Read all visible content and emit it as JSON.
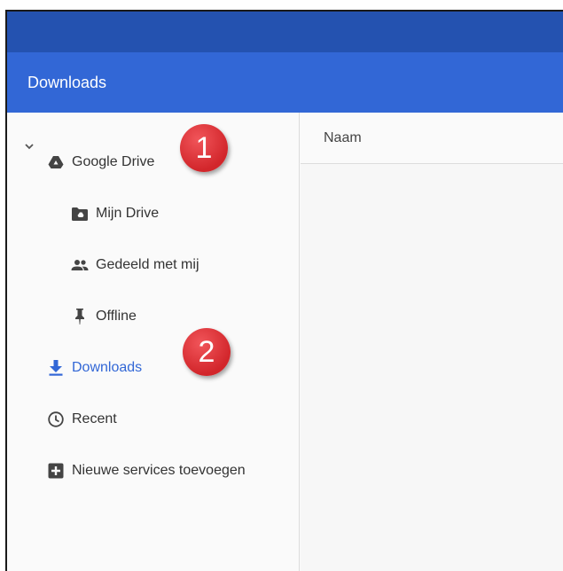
{
  "header": {
    "title": "Downloads"
  },
  "sidebar": {
    "items": [
      {
        "label": "Google Drive",
        "icon": "google-drive-icon"
      },
      {
        "label": "Mijn Drive",
        "icon": "my-drive-folder-icon"
      },
      {
        "label": "Gedeeld met mij",
        "icon": "shared-people-icon"
      },
      {
        "label": "Offline",
        "icon": "pin-icon"
      },
      {
        "label": "Downloads",
        "icon": "download-icon"
      },
      {
        "label": "Recent",
        "icon": "clock-icon"
      },
      {
        "label": "Nieuwe services toevoegen",
        "icon": "add-box-icon"
      }
    ]
  },
  "main": {
    "column_name": "Naam"
  },
  "annotations": {
    "badge_1": "1",
    "badge_2": "2"
  },
  "colors": {
    "titlebar": "#2452b0",
    "header": "#3267d6",
    "accent": "#3267d6",
    "badge": "#d2262b"
  }
}
